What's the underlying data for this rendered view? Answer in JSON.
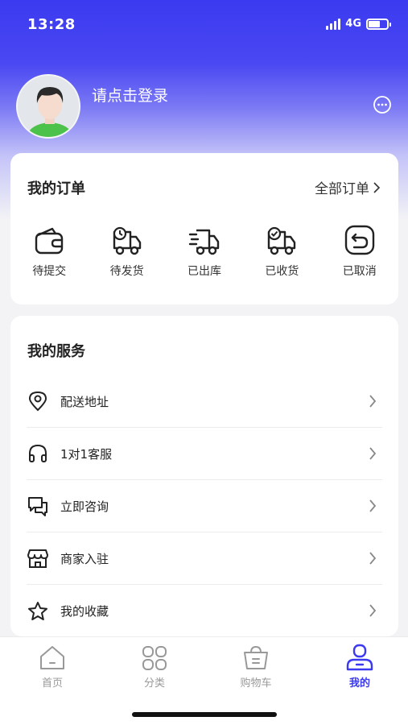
{
  "status_bar": {
    "time": "13:28",
    "network": "4G",
    "battery_level": 0.65,
    "signal_bars": 4
  },
  "profile": {
    "login_prompt": "请点击登录",
    "message_icon": "chat-bubble-dots-icon",
    "avatar_icon": "user-avatar-icon"
  },
  "orders": {
    "title": "我的订单",
    "all_orders": "全部订单",
    "items": [
      {
        "label": "待提交",
        "icon": "wallet-icon"
      },
      {
        "label": "待发货",
        "icon": "truck-clock-icon"
      },
      {
        "label": "已出库",
        "icon": "truck-moving-icon"
      },
      {
        "label": "已收货",
        "icon": "truck-check-icon"
      },
      {
        "label": "已取消",
        "icon": "return-icon"
      }
    ]
  },
  "services": {
    "title": "我的服务",
    "items": [
      {
        "label": "配送地址",
        "icon": "location-pin-icon"
      },
      {
        "label": "1对1客服",
        "icon": "headphones-icon"
      },
      {
        "label": "立即咨询",
        "icon": "chat-bubbles-icon"
      },
      {
        "label": "商家入驻",
        "icon": "storefront-icon"
      },
      {
        "label": "我的收藏",
        "icon": "star-icon"
      }
    ]
  },
  "tabbar": {
    "tabs": [
      {
        "label": "首页",
        "icon": "home-icon",
        "active": false
      },
      {
        "label": "分类",
        "icon": "grid-icon",
        "active": false
      },
      {
        "label": "购物车",
        "icon": "shopping-basket-icon",
        "active": false
      },
      {
        "label": "我的",
        "icon": "user-profile-icon",
        "active": true
      }
    ]
  },
  "colors": {
    "accent": "#3b3af0",
    "inactive_tab": "#999999"
  }
}
